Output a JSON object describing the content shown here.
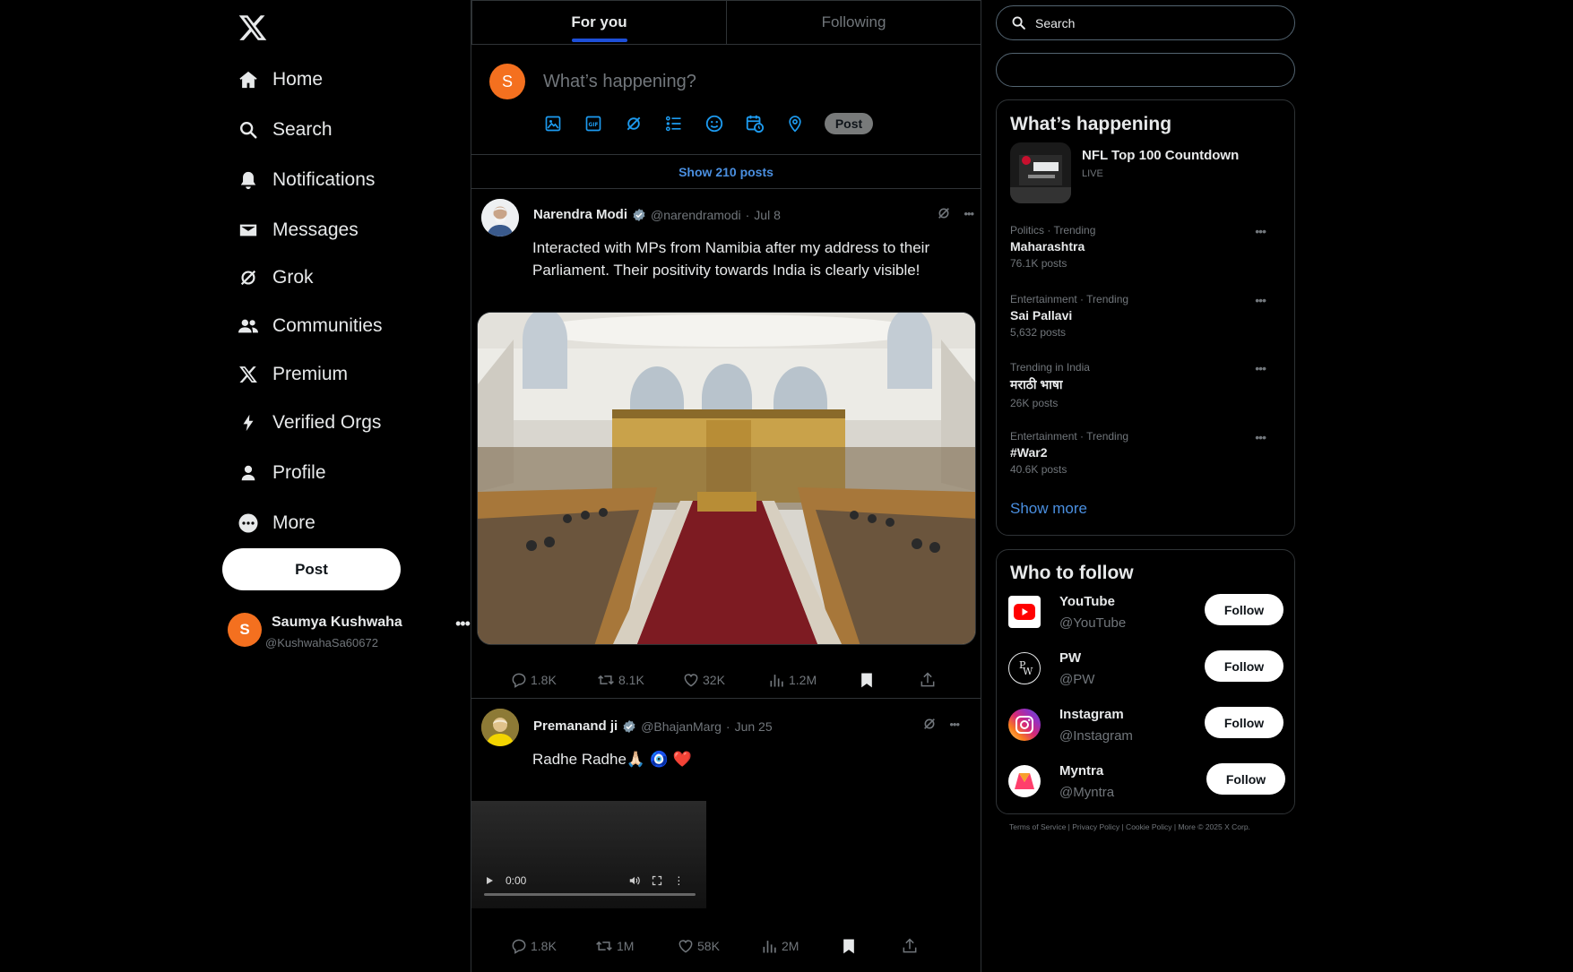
{
  "nav": {
    "items": [
      {
        "label": "Home",
        "icon": "home-icon"
      },
      {
        "label": "Search",
        "icon": "search-icon"
      },
      {
        "label": "Notifications",
        "icon": "bell-icon"
      },
      {
        "label": "Messages",
        "icon": "envelope-icon"
      },
      {
        "label": "Grok",
        "icon": "grok-icon"
      },
      {
        "label": "Communities",
        "icon": "people-icon"
      },
      {
        "label": "Premium",
        "icon": "x-logo-icon"
      },
      {
        "label": "Verified Orgs",
        "icon": "lightning-icon"
      },
      {
        "label": "Profile",
        "icon": "person-icon"
      },
      {
        "label": "More",
        "icon": "more-circle-icon"
      }
    ],
    "post_label": "Post",
    "account": {
      "initial": "S",
      "name": "Saumya Kushwaha",
      "handle": "@KushwahaSa60672"
    }
  },
  "tabs": [
    {
      "label": "For you",
      "active": true
    },
    {
      "label": "Following",
      "active": false
    }
  ],
  "composer": {
    "initial": "S",
    "placeholder": "What’s happening?",
    "post_label": "Post"
  },
  "show_posts": "Show 210 posts",
  "tweets": [
    {
      "name": "Narendra Modi",
      "handle": "@narendramodi",
      "date": "Jul 8",
      "text": "Interacted with MPs from Namibia after my address to their Parliament. Their positivity towards India is clearly visible!",
      "replies": "1.8K",
      "reposts": "8.1K",
      "likes": "32K",
      "views": "1.2M"
    },
    {
      "name": "Premanand ji",
      "handle": "@BhajanMarg",
      "date": "Jun 25",
      "text": "Radhe Radhe🙏🏻 🧿 ❤️",
      "video_time": "0:00",
      "replies": "1.8K",
      "reposts": "1M",
      "likes": "58K",
      "views": "2M"
    }
  ],
  "right": {
    "search_placeholder": "Search",
    "happening": {
      "title": "What’s happening",
      "featured": {
        "title": "NFL Top 100 Countdown",
        "status": "LIVE"
      },
      "trends": [
        {
          "category": "Politics · Trending",
          "title": "Maharashtra",
          "count": "76.1K posts"
        },
        {
          "category": "Entertainment · Trending",
          "title": "Sai Pallavi",
          "count": "5,632 posts"
        },
        {
          "category": "Trending in India",
          "title": "मराठी भाषा",
          "count": "26K posts"
        },
        {
          "category": "Entertainment · Trending",
          "title": "#War2",
          "count": "40.6K posts"
        }
      ],
      "show_more": "Show more"
    },
    "who_to_follow": {
      "title": "Who to follow",
      "accounts": [
        {
          "name": "YouTube",
          "handle": "@YouTube",
          "follow": "Follow"
        },
        {
          "name": "PW",
          "handle": "@PW",
          "follow": "Follow"
        },
        {
          "name": "Instagram",
          "handle": "@Instagram",
          "follow": "Follow"
        },
        {
          "name": "Myntra",
          "handle": "@Myntra",
          "follow": "Follow"
        }
      ]
    },
    "footer": "Terms of Service | Privacy Policy | Cookie Policy | More © 2025 X Corp."
  }
}
